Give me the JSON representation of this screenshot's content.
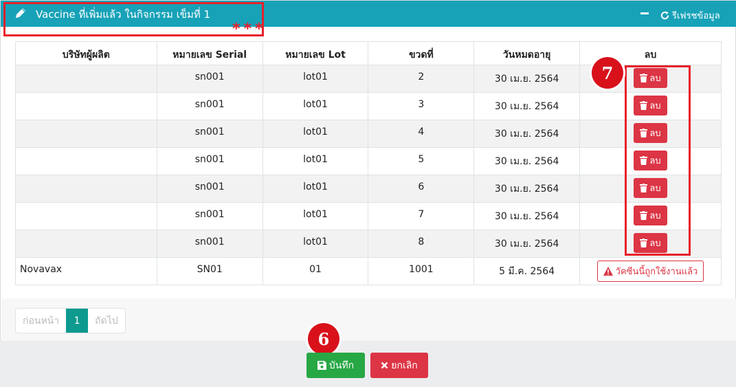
{
  "header": {
    "title": "Vaccine ที่เพิ่มแล้ว ในกิจกรรม เข็มที่ 1",
    "stars": "***",
    "refresh_label": "รีเฟรชข้อมูล"
  },
  "table": {
    "columns": [
      "บริษัทผู้ผลิต",
      "หมายเลข Serial",
      "หมายเลข Lot",
      "ขวดที่",
      "วันหมดอายุ",
      "ลบ"
    ],
    "rows": [
      {
        "company": "",
        "serial": "sn001",
        "lot": "lot01",
        "bottle": "2",
        "expiry": "30 เม.ย. 2564",
        "action": "ลบ"
      },
      {
        "company": "",
        "serial": "sn001",
        "lot": "lot01",
        "bottle": "3",
        "expiry": "30 เม.ย. 2564",
        "action": "ลบ"
      },
      {
        "company": "",
        "serial": "sn001",
        "lot": "lot01",
        "bottle": "4",
        "expiry": "30 เม.ย. 2564",
        "action": "ลบ"
      },
      {
        "company": "",
        "serial": "sn001",
        "lot": "lot01",
        "bottle": "5",
        "expiry": "30 เม.ย. 2564",
        "action": "ลบ"
      },
      {
        "company": "",
        "serial": "sn001",
        "lot": "lot01",
        "bottle": "6",
        "expiry": "30 เม.ย. 2564",
        "action": "ลบ"
      },
      {
        "company": "",
        "serial": "sn001",
        "lot": "lot01",
        "bottle": "7",
        "expiry": "30 เม.ย. 2564",
        "action": "ลบ"
      },
      {
        "company": "",
        "serial": "sn001",
        "lot": "lot01",
        "bottle": "8",
        "expiry": "30 เม.ย. 2564",
        "action": "ลบ"
      },
      {
        "company": "Novavax",
        "serial": "SN01",
        "lot": "01",
        "bottle": "1001",
        "expiry": "5 มี.ค. 2564",
        "action": "วัคซีนนี้ถูกใช้งานแล้ว"
      }
    ]
  },
  "pagination": {
    "prev": "ก่อนหน้า",
    "current": "1",
    "next": "ถัดไป"
  },
  "actions": {
    "save": "บันทึก",
    "cancel": "ยกเลิก"
  },
  "markers": {
    "delete_marker": "7",
    "save_marker": "6"
  },
  "colors": {
    "header": "#17a2b8",
    "danger": "#dc3545",
    "success": "#28a745",
    "highlight": "#e8202a",
    "active_page": "#0e9a8f"
  }
}
